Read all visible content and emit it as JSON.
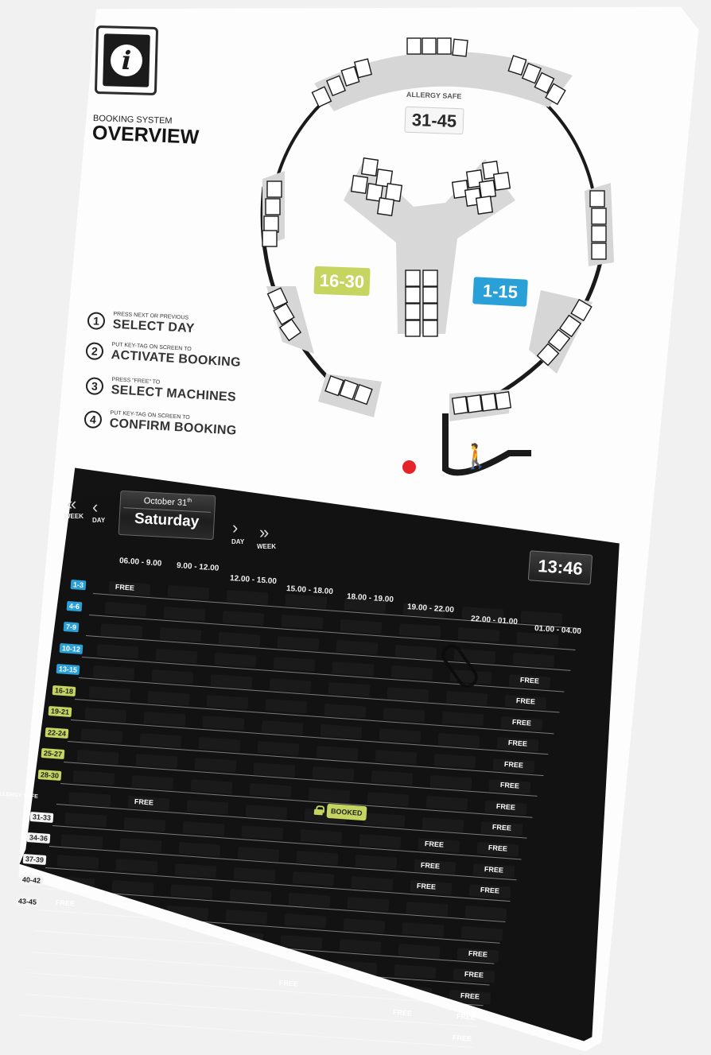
{
  "header": {
    "logo_icon": "info-icon",
    "logo_glyph": "i",
    "subtitle": "BOOKING SYSTEM",
    "title": "OVERVIEW"
  },
  "steps": [
    {
      "num": "1",
      "small": "PRESS NEXT OR PREVIOUS",
      "big": "SELECT DAY"
    },
    {
      "num": "2",
      "small": "PUT KEY-TAG ON SCREEN TO",
      "big": "ACTIVATE BOOKING"
    },
    {
      "num": "3",
      "small": "PRESS \"FREE\" TO",
      "big": "SELECT MACHINES"
    },
    {
      "num": "4",
      "small": "PUT KEY-TAG ON SCREEN TO",
      "big": "CONFIRM BOOKING"
    }
  ],
  "floorplan": {
    "allergy_caption": "ALLERGY SAFE",
    "zones": {
      "allergy": "31-45",
      "green": "16-30",
      "blue": "1-15"
    },
    "colors": {
      "green": "#c5d560",
      "blue": "#2aa0d8",
      "red_dot": "#e5242a"
    },
    "person_icon": "person-icon"
  },
  "nav": {
    "prev_week_label": "WEEK",
    "prev_day_label": "DAY",
    "next_day_label": "DAY",
    "next_week_label": "WEEK",
    "prev_week_icon": "double-chevron-left-icon",
    "prev_day_icon": "chevron-left-icon",
    "next_day_icon": "chevron-right-icon",
    "next_week_icon": "double-chevron-right-icon"
  },
  "date": {
    "month": "October",
    "day_num": "31",
    "suffix": "th",
    "weekday": "Saturday"
  },
  "clock": {
    "time": "13:46"
  },
  "schedule": {
    "time_slots": [
      "06.00 - 9.00",
      "9.00 - 12.00",
      "12.00 - 15.00",
      "15.00 - 18.00",
      "18.00 - 19.00",
      "19.00 - 22.00",
      "22.00 - 01.00",
      "01.00 - 04.00"
    ],
    "rows": [
      {
        "label": "1-3",
        "style": "blue"
      },
      {
        "label": "4-6",
        "style": "blue"
      },
      {
        "label": "7-9",
        "style": "blue"
      },
      {
        "label": "10-12",
        "style": "blue"
      },
      {
        "label": "13-15",
        "style": "blue"
      },
      {
        "label": "16-18",
        "style": "green"
      },
      {
        "label": "19-21",
        "style": "green"
      },
      {
        "label": "22-24",
        "style": "green"
      },
      {
        "label": "25-27",
        "style": "green"
      },
      {
        "label": "28-30",
        "style": "green"
      },
      {
        "label": "ALLERGY SAFE",
        "style": "plain"
      },
      {
        "label": "31-33",
        "style": "white"
      },
      {
        "label": "34-36",
        "style": "white"
      },
      {
        "label": "37-39",
        "style": "white"
      },
      {
        "label": "40-42",
        "style": "white"
      },
      {
        "label": "43-45",
        "style": "white"
      }
    ],
    "free_label": "FREE",
    "booked_label": "BOOKED",
    "free_cells": [
      {
        "row": 0,
        "col": 0
      },
      {
        "row": 3,
        "col": 7
      },
      {
        "row": 4,
        "col": 7
      },
      {
        "row": 5,
        "col": 7
      },
      {
        "row": 6,
        "col": 7
      },
      {
        "row": 7,
        "col": 7
      },
      {
        "row": 8,
        "col": 7
      },
      {
        "row": 9,
        "col": 7
      },
      {
        "row": 10,
        "col": 1
      },
      {
        "row": 10,
        "col": 7
      },
      {
        "row": 11,
        "col": 6
      },
      {
        "row": 11,
        "col": 7
      },
      {
        "row": 12,
        "col": 6
      },
      {
        "row": 12,
        "col": 7
      },
      {
        "row": 13,
        "col": 6
      },
      {
        "row": 13,
        "col": 7
      },
      {
        "row": 15,
        "col": 0
      },
      {
        "row": 16,
        "col": 7
      },
      {
        "row": 17,
        "col": 7
      },
      {
        "row": 18,
        "col": 4
      },
      {
        "row": 18,
        "col": 6
      },
      {
        "row": 18,
        "col": 7
      },
      {
        "row": 19,
        "col": 6
      },
      {
        "row": 19,
        "col": 7
      },
      {
        "row": 20,
        "col": 7
      }
    ],
    "booked_cell": {
      "row": 10,
      "col": 4
    }
  }
}
